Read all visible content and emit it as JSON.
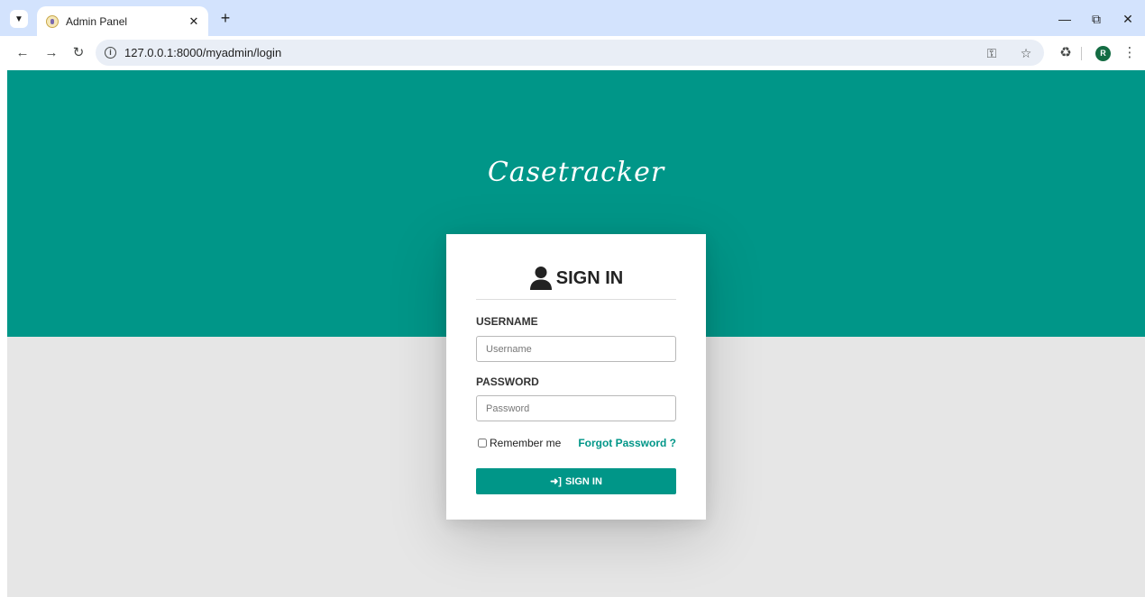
{
  "browser": {
    "tab_title": "Admin Panel",
    "url": "127.0.0.1:8000/myadmin/login",
    "profile_initial": "R"
  },
  "page": {
    "brand": "Casetracker",
    "colors": {
      "primary": "#009688",
      "background": "#e6e6e6",
      "card": "#ffffff"
    },
    "form": {
      "title": "SIGN IN",
      "username_label": "USERNAME",
      "username_placeholder": "Username",
      "username_value": "",
      "password_label": "PASSWORD",
      "password_placeholder": "Password",
      "password_value": "",
      "remember_label": "Remember me",
      "remember_checked": false,
      "forgot_label": "Forgot Password ?",
      "submit_label": "SIGN IN"
    }
  },
  "icons": {
    "tab_list": "chevron-down-icon",
    "favicon": "admin-favicon-icon",
    "close": "close-icon",
    "new_tab": "plus-icon",
    "back": "arrow-left-icon",
    "forward": "arrow-right-icon",
    "reload": "reload-icon",
    "site_info": "info-icon",
    "password_key": "key-icon",
    "bookmark": "star-icon",
    "extensions": "puzzle-icon",
    "menu": "kebab-menu-icon",
    "user": "user-icon",
    "login": "sign-in-icon"
  }
}
